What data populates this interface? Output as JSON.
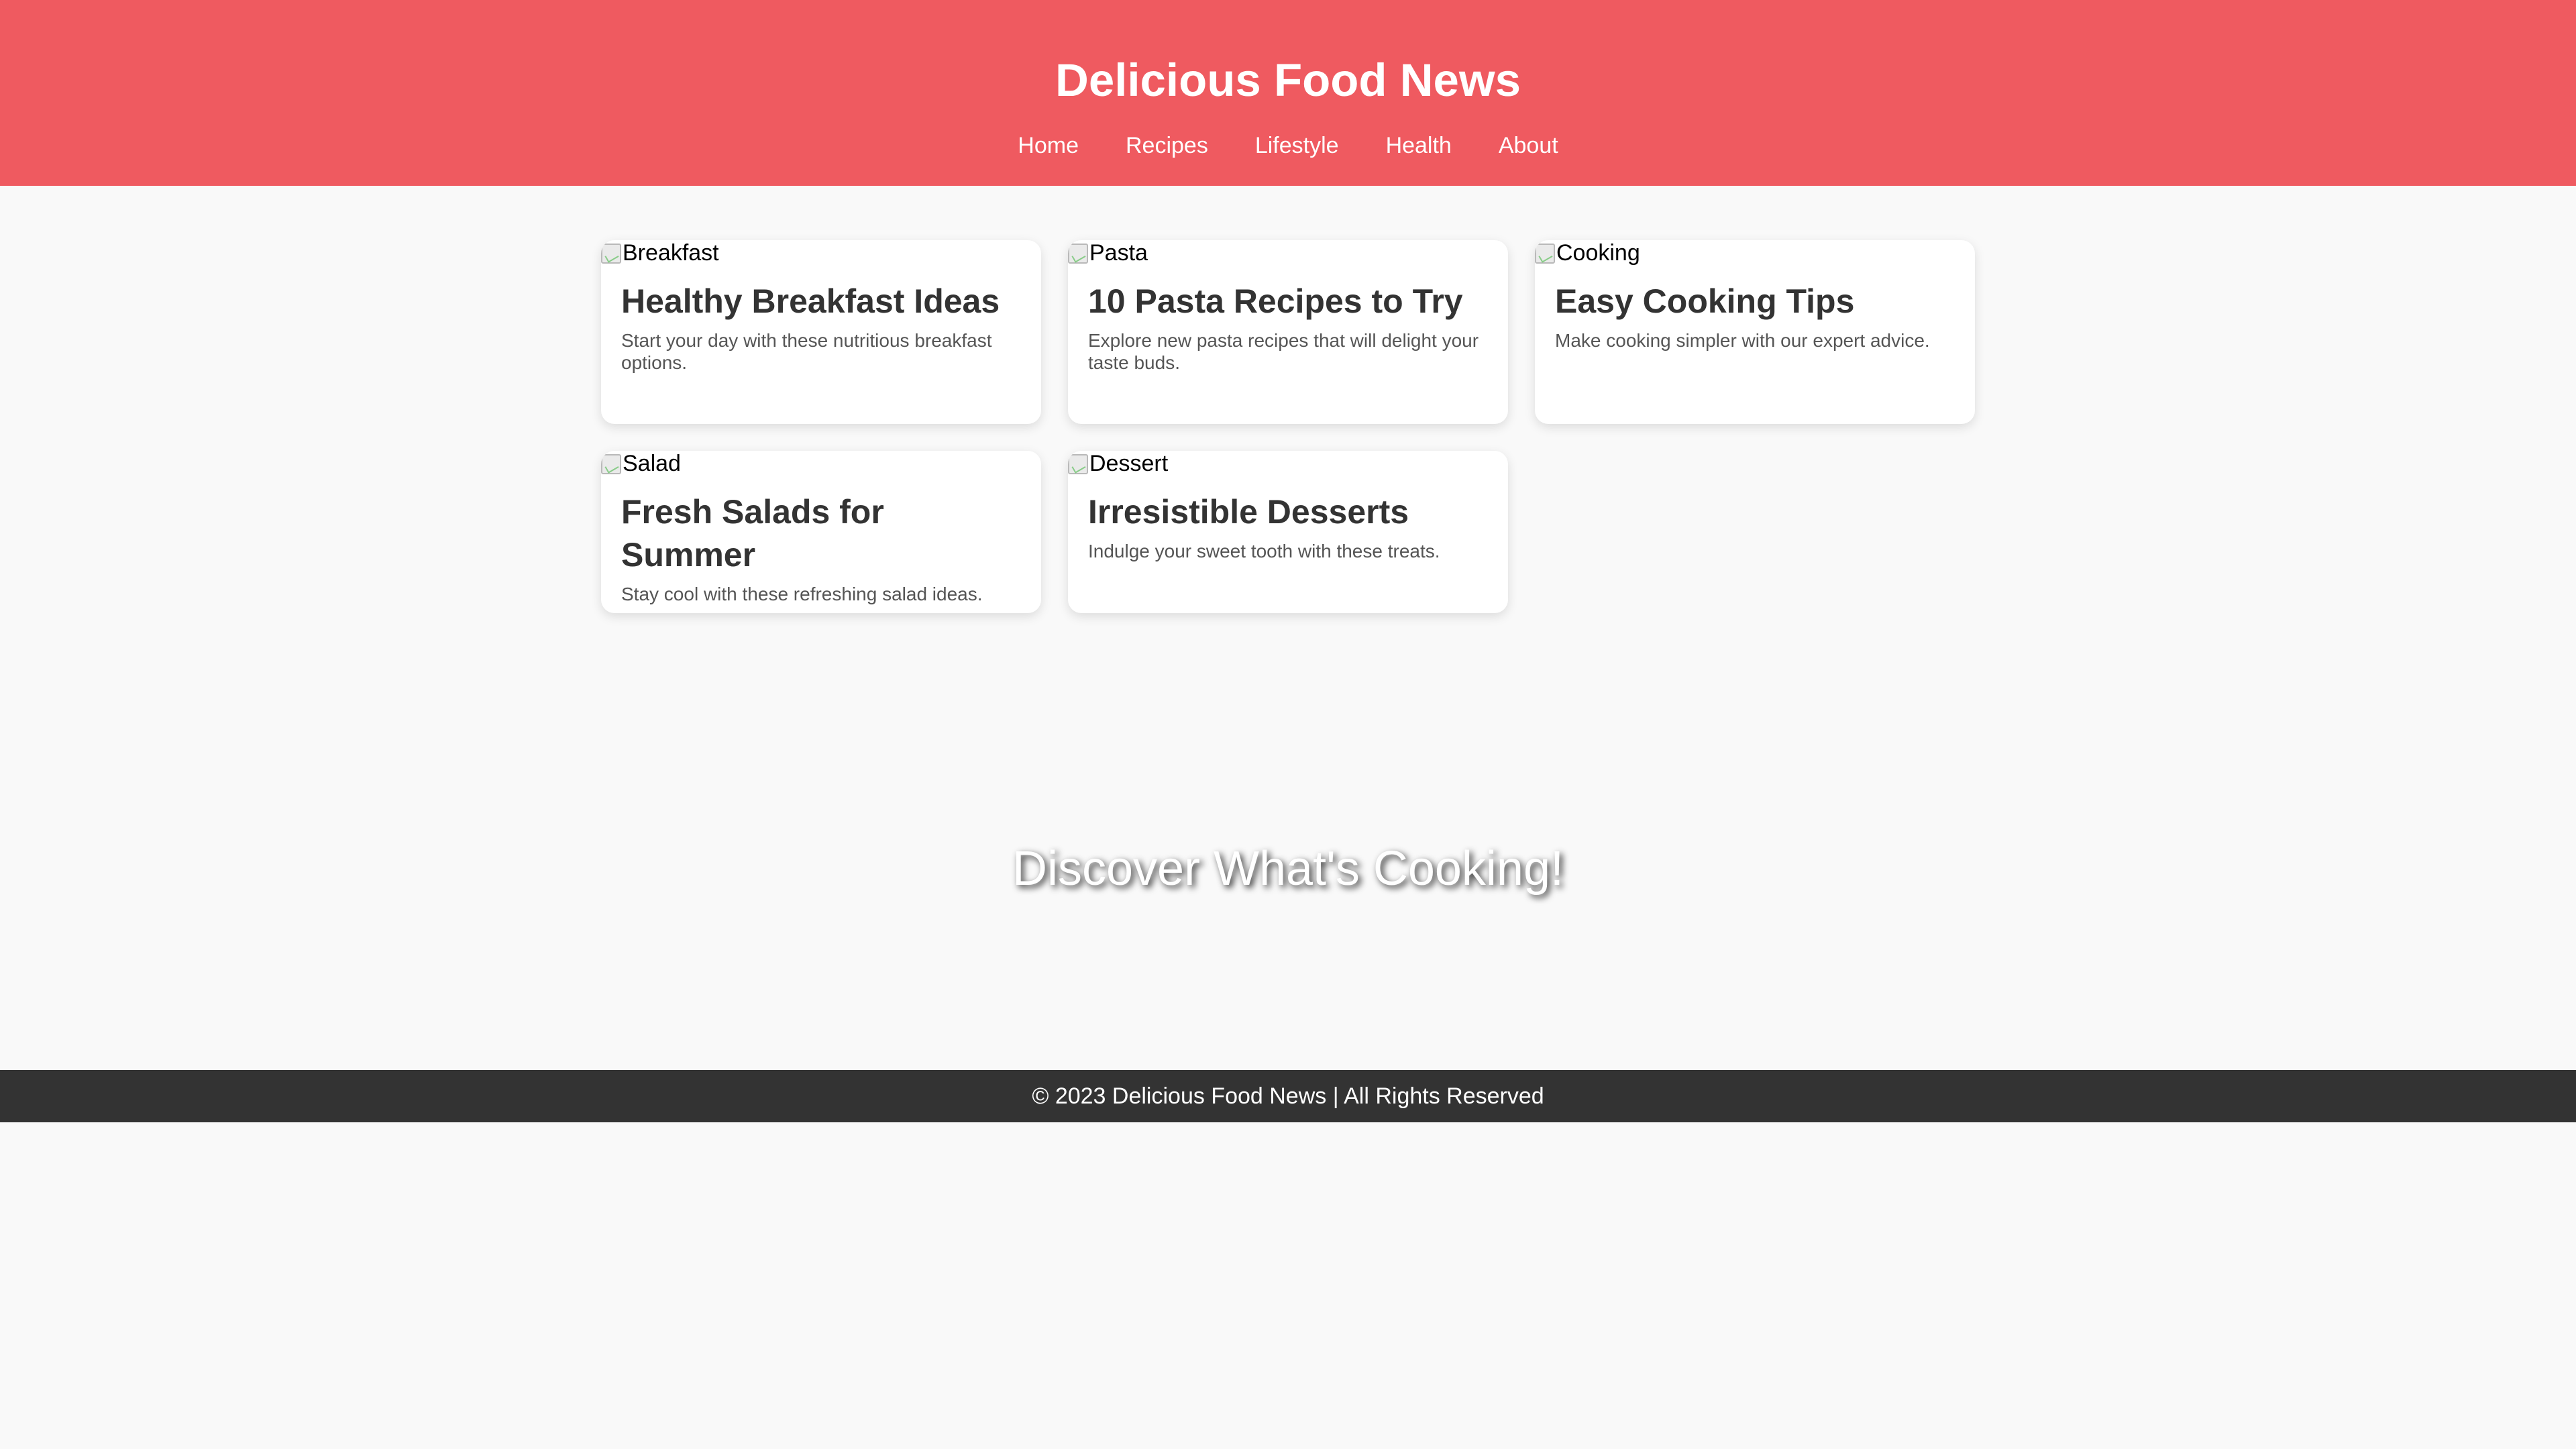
{
  "header": {
    "title": "Delicious Food News",
    "background": "#ef5a60",
    "nav": [
      "Home",
      "Recipes",
      "Lifestyle",
      "Health",
      "About"
    ]
  },
  "cards": [
    {
      "image_alt": "Breakfast",
      "title": "Healthy Breakfast Ideas",
      "description": "Start your day with these nutritious breakfast options."
    },
    {
      "image_alt": "Pasta",
      "title": "10 Pasta Recipes to Try",
      "description": "Explore new pasta recipes that will delight your taste buds."
    },
    {
      "image_alt": "Cooking",
      "title": "Easy Cooking Tips",
      "description": "Make cooking simpler with our expert advice."
    },
    {
      "image_alt": "Salad",
      "title": "Fresh Salads for Summer",
      "description": "Stay cool with these refreshing salad ideas."
    },
    {
      "image_alt": "Dessert",
      "title": "Irresistible Desserts",
      "description": "Indulge your sweet tooth with these treats."
    }
  ],
  "hero": {
    "text": "Discover What's Cooking!"
  },
  "footer": {
    "text": "© 2023 Delicious Food News | All Rights Reserved",
    "background": "#333333"
  }
}
